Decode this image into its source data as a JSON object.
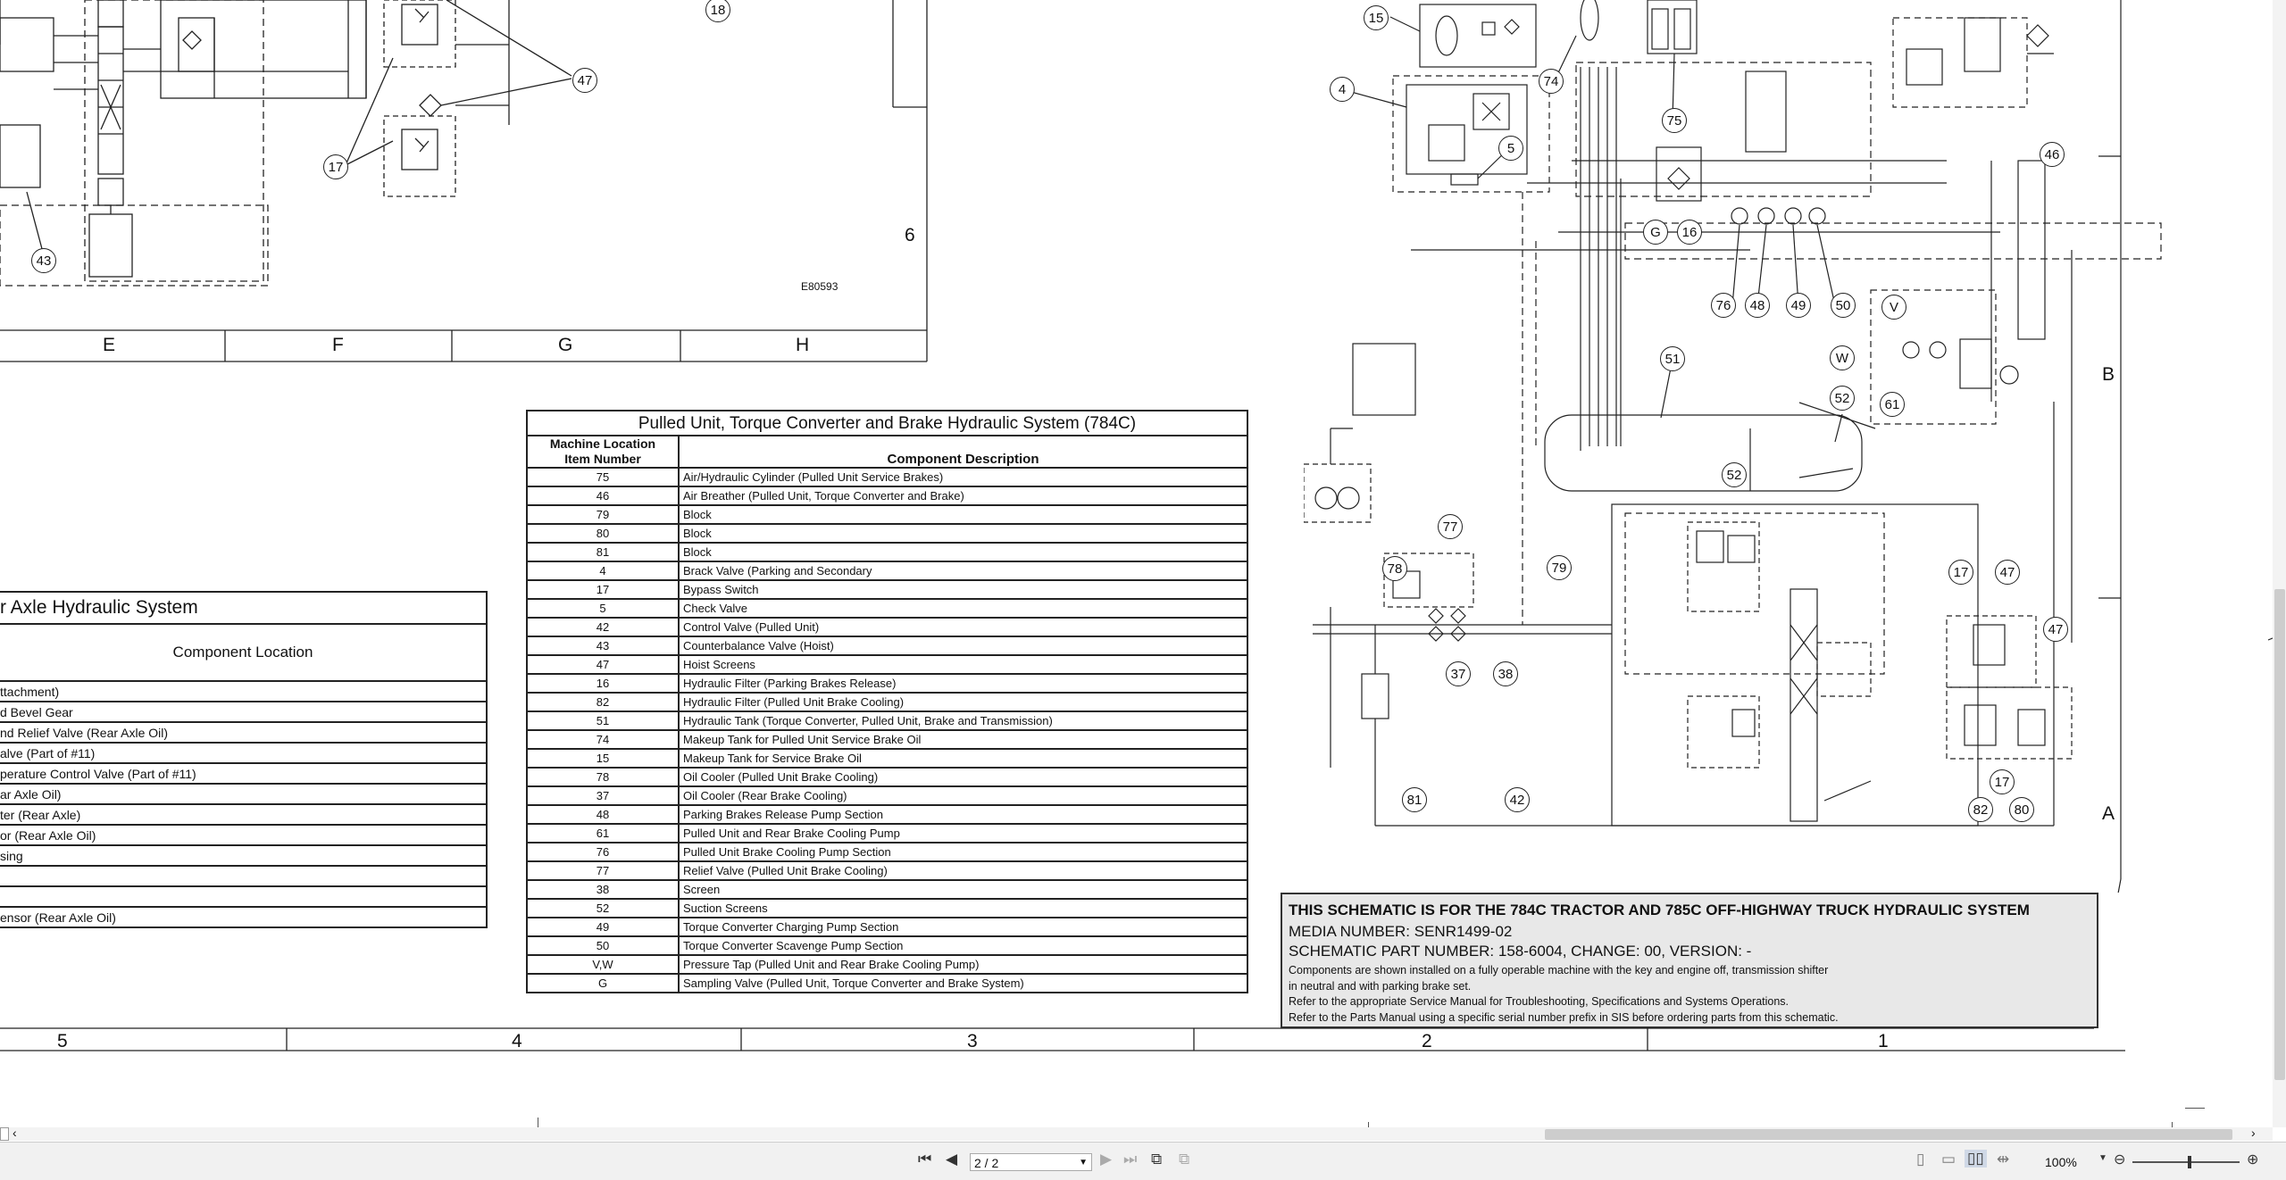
{
  "drawing": {
    "code": "E80593",
    "zone_letters_bottom": [
      "E",
      "F",
      "G",
      "H"
    ],
    "zone_number_right": "6",
    "zone_letters_right": [
      "B",
      "A"
    ],
    "bottom_numbers": [
      "5",
      "4",
      "3",
      "2",
      "1"
    ],
    "callouts": [
      "18",
      "47",
      "17",
      "43",
      "15",
      "74",
      "4",
      "75",
      "5",
      "G",
      "16",
      "46",
      "76",
      "48",
      "49",
      "50",
      "V",
      "W",
      "61",
      "51",
      "52",
      "52",
      "77",
      "79",
      "78",
      "37",
      "38",
      "17",
      "47",
      "47",
      "17",
      "82",
      "80",
      "81",
      "42"
    ]
  },
  "axle_table": {
    "title": "r Axle Hydraulic System",
    "header": "Component Location",
    "rows": [
      "",
      "ttachment)",
      "d Bevel Gear",
      "nd Relief Valve (Rear Axle Oil)",
      "alve (Part of #11)",
      "perature Control Valve (Part of #11)",
      "ar Axle Oil)",
      "ter (Rear Axle)",
      "or (Rear Axle Oil)",
      "sing",
      "",
      "",
      "ensor (Rear Axle Oil)"
    ]
  },
  "component_table": {
    "title": "Pulled Unit, Torque Converter and Brake Hydraulic System (784C)",
    "col1_header_line1": "Machine Location",
    "col1_header_line2": "Item Number",
    "col2_header": "Component Description",
    "rows": [
      {
        "num": "75",
        "desc": "Air/Hydraulic Cylinder (Pulled Unit Service Brakes)"
      },
      {
        "num": "46",
        "desc": "Air Breather (Pulled Unit, Torque Converter and Brake)"
      },
      {
        "num": "79",
        "desc": "Block"
      },
      {
        "num": "80",
        "desc": "Block"
      },
      {
        "num": "81",
        "desc": "Block"
      },
      {
        "num": "4",
        "desc": "Brack Valve (Parking and Secondary"
      },
      {
        "num": "17",
        "desc": "Bypass Switch"
      },
      {
        "num": "5",
        "desc": "Check Valve"
      },
      {
        "num": "42",
        "desc": "Control Valve (Pulled Unit)"
      },
      {
        "num": "43",
        "desc": "Counterbalance Valve (Hoist)"
      },
      {
        "num": "47",
        "desc": "Hoist Screens"
      },
      {
        "num": "16",
        "desc": "Hydraulic Filter (Parking Brakes Release)"
      },
      {
        "num": "82",
        "desc": "Hydraulic Filter (Pulled Unit Brake Cooling)"
      },
      {
        "num": "51",
        "desc": "Hydraulic Tank (Torque Converter, Pulled Unit, Brake and Transmission)"
      },
      {
        "num": "74",
        "desc": "Makeup Tank for Pulled Unit Service Brake Oil"
      },
      {
        "num": "15",
        "desc": "Makeup Tank for Service Brake Oil"
      },
      {
        "num": "78",
        "desc": "Oil Cooler (Pulled Unit Brake Cooling)"
      },
      {
        "num": "37",
        "desc": "Oil Cooler (Rear Brake Cooling)"
      },
      {
        "num": "48",
        "desc": "Parking Brakes Release Pump Section"
      },
      {
        "num": "61",
        "desc": "Pulled Unit and Rear Brake Cooling Pump"
      },
      {
        "num": "76",
        "desc": "Pulled Unit Brake Cooling Pump Section"
      },
      {
        "num": "77",
        "desc": "Relief Valve (Pulled Unit Brake Cooling)"
      },
      {
        "num": "38",
        "desc": "Screen"
      },
      {
        "num": "52",
        "desc": "Suction Screens"
      },
      {
        "num": "49",
        "desc": "Torque Converter Charging Pump Section"
      },
      {
        "num": "50",
        "desc": "Torque Converter Scavenge Pump Section"
      },
      {
        "num": "V,W",
        "desc": "Pressure Tap (Pulled Unit and Rear Brake Cooling Pump)"
      },
      {
        "num": "G",
        "desc": "Sampling Valve (Pulled Unit, Torque Converter and Brake System)"
      }
    ]
  },
  "notes": {
    "line1": "THIS SCHEMATIC IS FOR THE 784C TRACTOR AND 785C OFF-HIGHWAY TRUCK HYDRAULIC SYSTEM",
    "line2": "MEDIA NUMBER: SENR1499-02",
    "line3": "SCHEMATIC PART NUMBER: 158-6004, CHANGE: 00, VERSION: -",
    "line4": "Components are shown installed on a fully operable machine with the key and engine off, transmission shifter",
    "line5": "in neutral and with parking brake set.",
    "line6": "Refer to the appropriate Service Manual for Troubleshooting, Specifications and Systems Operations.",
    "line7": "Refer to the Parts Manual using a specific serial number prefix in SIS before ordering parts from this schematic."
  },
  "viewer": {
    "page_indicator": "2 / 2",
    "zoom": "100%"
  }
}
